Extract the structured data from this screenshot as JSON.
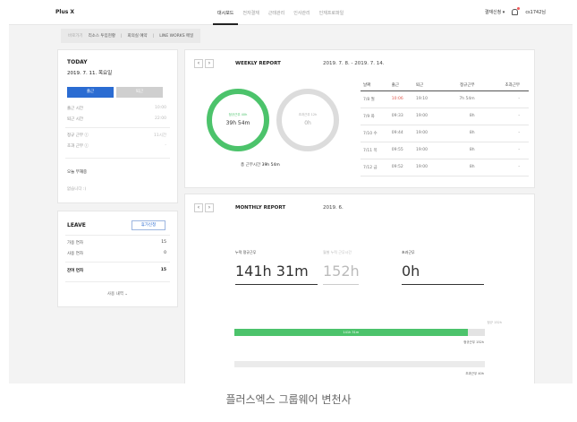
{
  "app": {
    "logo": "Plus X"
  },
  "nav": [
    "대시보드",
    "전자결재",
    "근태관리",
    "인사관리",
    "인재프로파일"
  ],
  "topright": {
    "approval": "결재신청 ▾",
    "user": "cs1742님"
  },
  "subbar": {
    "first": "바로가기",
    "items": [
      "리소스 투입현황",
      "회의실 예약",
      "LINE WORKS 메일"
    ]
  },
  "today": {
    "title": "TODAY",
    "date": "2019. 7. 11. 목요일",
    "btn_in": "출근",
    "btn_out": "퇴근",
    "rows": [
      {
        "label": "출근 시간",
        "value": "10:00"
      },
      {
        "label": "퇴근 시간",
        "value": "22:00"
      },
      {
        "label": "정규 근무 ⓘ",
        "value": "11시간"
      },
      {
        "label": "초과 근무 ⓘ",
        "value": "-"
      }
    ],
    "memo_title": "오늘 부재중",
    "memo_text": "없습니다 :)"
  },
  "leave": {
    "title": "LEAVE",
    "button": "휴가신청",
    "rows": [
      {
        "label": "가용 연차",
        "value": "15"
      },
      {
        "label": "사용 연차",
        "value": "0"
      },
      {
        "label": "잔여 연차",
        "value": "15"
      }
    ],
    "history": "사용 내역 ⌄"
  },
  "weekly": {
    "title": "WEEKLY REPORT",
    "range": "2019. 7. 8. - 2019. 7. 14.",
    "circle1_label": "정규근무 40h",
    "circle1_value": "39h 54m",
    "circle2_label": "초과근무 12h",
    "circle2_value": "0h",
    "total_label": "총 근무시간",
    "total_value": "39h 54m",
    "columns": [
      "날짜",
      "출근",
      "퇴근",
      "정규근무",
      "초과근무"
    ],
    "rows": [
      [
        "7/8 월",
        "10:06",
        "19:10",
        "7h 54m",
        "-"
      ],
      [
        "7/9 화",
        "09:33",
        "19:00",
        "8h",
        "-"
      ],
      [
        "7/10 수",
        "09:44",
        "19:00",
        "8h",
        "-"
      ],
      [
        "7/11 목",
        "09:55",
        "19:00",
        "8h",
        "-"
      ],
      [
        "7/12 금",
        "09:52",
        "19:00",
        "8h",
        "-"
      ]
    ],
    "accent": "#4cc36b"
  },
  "monthly": {
    "title": "MONTHLY REPORT",
    "month": "2019. 6.",
    "stat1_label": "누적 정규근무",
    "stat1_value": "141h 31m",
    "stat2_label": "월별 누적 근무시간",
    "stat2_value": "152h",
    "stat3_label": "초과근무",
    "stat3_value": "0h",
    "bar_label_right": "정규 152h",
    "bar_fill_text": "141h 31m",
    "bar_fill_fraction": 0.931,
    "bar_bottom_label": "정규근무 152h",
    "bar2_label": "초과근무 40h"
  },
  "caption": "플러스엑스 그룹웨어 변천사"
}
